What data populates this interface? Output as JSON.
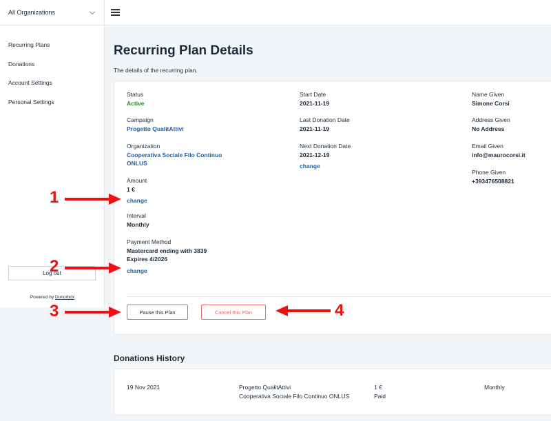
{
  "sidebar": {
    "org_select": "All Organizations",
    "items": [
      {
        "label": "Recurring Plans"
      },
      {
        "label": "Donations"
      },
      {
        "label": "Account Settings"
      },
      {
        "label": "Personal Settings"
      }
    ],
    "logout_label": "Log out",
    "powered_by": "Powered by",
    "powered_link": "Donorbox"
  },
  "page": {
    "title": "Recurring Plan Details",
    "subtitle": "The details of the recurring plan."
  },
  "plan": {
    "status_label": "Status",
    "status_value": "Active",
    "campaign_label": "Campaign",
    "campaign_value": "Progetto QualitAttivi",
    "organization_label": "Organization",
    "organization_value_line1": "Cooperativa Sociale Filo Continuo",
    "organization_value_line2": "ONLUS",
    "amount_label": "Amount",
    "amount_value": "1 €",
    "amount_change": "change",
    "interval_label": "Interval",
    "interval_value": "Monthly",
    "payment_label": "Payment Method",
    "payment_value_line1": "Mastercard ending with 3839",
    "payment_value_line2": "Expires 4/2026",
    "payment_change": "change",
    "start_label": "Start Date",
    "start_value": "2021-11-19",
    "last_label": "Last Donation Date",
    "last_value": "2021-11-19",
    "next_label": "Next Donation Date",
    "next_value": "2021-12-19",
    "next_change": "change",
    "name_label": "Name Given",
    "name_value": "Simone Corsi",
    "address_label": "Address Given",
    "address_value": "No Address",
    "email_label": "Email Given",
    "email_value": "info@maurocorsi.it",
    "phone_label": "Phone Given",
    "phone_value": "+393476508821",
    "pause_label": "Pause this Plan",
    "cancel_label": "Cancel this Plan"
  },
  "history": {
    "title": "Donations History",
    "rows": [
      {
        "date": "19 Nov 2021",
        "campaign": "Progetto QualitAttivi",
        "organization": "Cooperativa Sociale Filo Continuo ONLUS",
        "amount": "1 €",
        "status": "Paid",
        "interval": "Monthly"
      }
    ]
  },
  "annotations": [
    "1",
    "2",
    "3",
    "4"
  ],
  "colors": {
    "accent_blue": "#1d5fa6",
    "status_green": "#228b22",
    "cancel_red": "#e36b6b",
    "annotation_red": "#ee1111"
  }
}
